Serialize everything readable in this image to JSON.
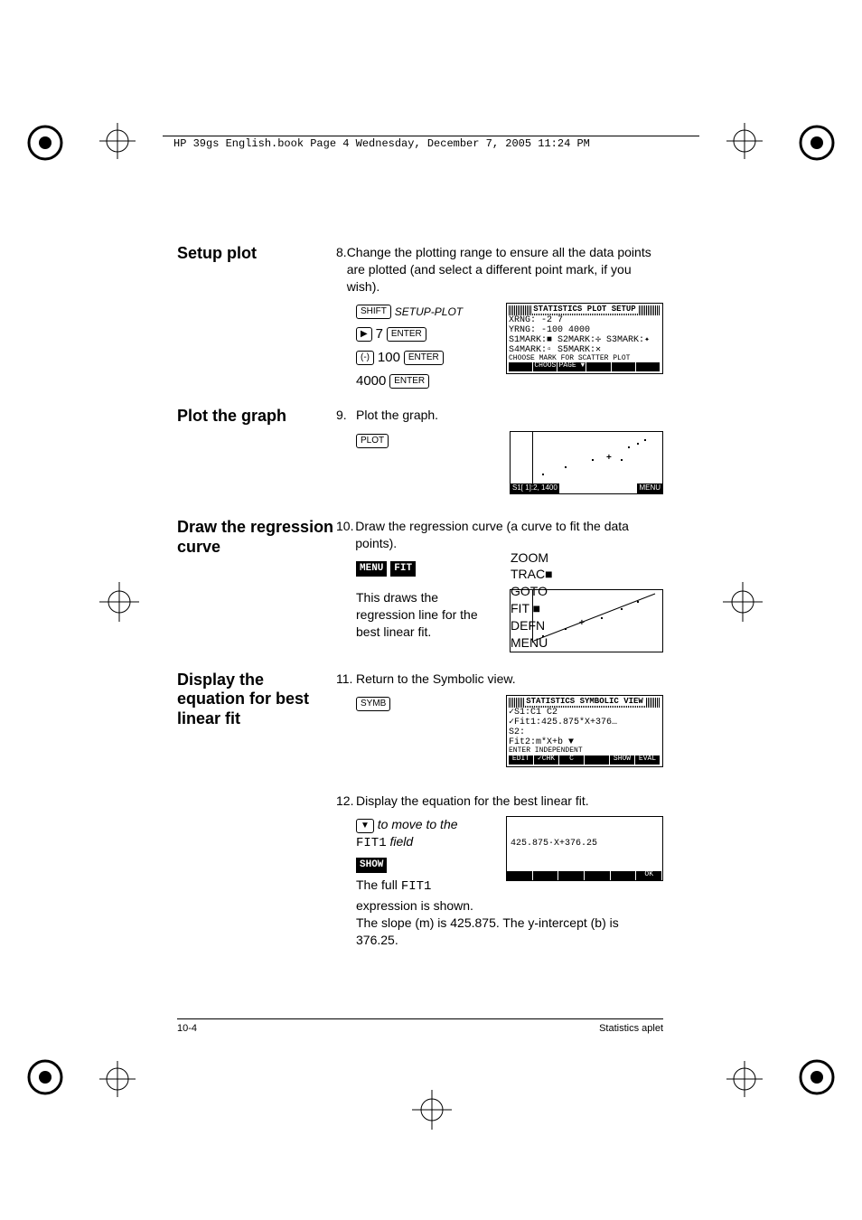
{
  "header": "HP 39gs English.book  Page 4  Wednesday, December 7, 2005  11:24 PM",
  "sections": {
    "setup_plot": {
      "heading": "Setup plot",
      "step_num": "8.",
      "text": "Change the plotting range to ensure all the data points are plotted (and select a different point mark, if you wish).",
      "keys": {
        "shift": "SHIFT",
        "setup_plot": "SETUP-PLOT",
        "seven": "7",
        "enter1": "ENTER",
        "neg": "(-)",
        "hundred": "100",
        "enter2": "ENTER",
        "fourk": "4000",
        "enter3": "ENTER"
      },
      "screen": {
        "title": "STATISTICS PLOT SETUP",
        "l1": "XRNG: -2        7",
        "l2": "YRNG: -100     4000",
        "l3": "S1MARK:■ S2MARK:✢ S3MARK:✦",
        "l4": "S4MARK:▫ S5MARK:✕",
        "l5": "CHOOSE MARK FOR SCATTER PLOT",
        "menu1": "CHOOS",
        "menu2": "PAGE ▼"
      }
    },
    "plot_graph": {
      "heading": "Plot the graph",
      "step_num": "9.",
      "text": "Plot the graph.",
      "key": "PLOT",
      "screen_status_left": "S1[ 1]:2, 1400",
      "screen_status_right": "MENU"
    },
    "draw_curve": {
      "heading": "Draw the regression curve",
      "step_num": "10.",
      "text": "Draw the regression curve (a curve to fit the data points).",
      "menu_key": "MENU",
      "fit_key": "FIT",
      "desc": "This draws the regression line for the best linear fit.",
      "menus": [
        "ZOOM",
        "TRAC■",
        "GOTO",
        "FIT ■",
        "DEFN",
        "MENU"
      ]
    },
    "display_eq": {
      "heading": "Display the equation for best linear fit",
      "step_num": "11.",
      "text": "Return to the Symbolic view.",
      "key": "SYMB",
      "screen": {
        "title": "STATISTICS SYMBOLIC VIEW",
        "l1": "✓S1:C1       C2",
        "l2": "✓Fit1:425.875*X+376…",
        "l3": " S2:",
        "l4": " Fit2:m*X+b        ▼",
        "l5": "ENTER INDEPENDENT",
        "menus": [
          "EDIT",
          "✓CHK",
          "C",
          "",
          "SHOW",
          "EVAL"
        ]
      },
      "step12_num": "12.",
      "step12_text": "Display the equation for the best linear fit.",
      "sub_instr1_prefix": "to move to the",
      "sub_instr1_mono": "FIT1",
      "sub_instr1_suffix": "field",
      "show_key": "SHOW",
      "fit_desc_prefix": "The full ",
      "fit_desc_mono": "FIT1",
      "fit_desc_suffix": " expression is shown.",
      "slope_line": "The slope (m) is 425.875. The y-intercept (b) is 376.25.",
      "eq_screen": {
        "eq": "425.875·X+376.25",
        "ok": "OK"
      }
    }
  },
  "footer": {
    "page": "10-4",
    "title": "Statistics aplet"
  }
}
